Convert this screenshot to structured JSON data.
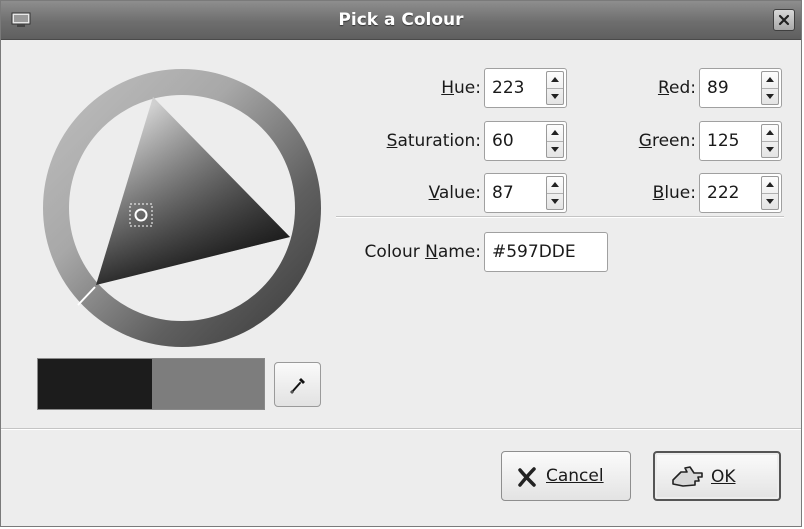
{
  "window": {
    "title": "Pick a Colour"
  },
  "icons": {
    "window": "window-menu-icon",
    "close": "close-icon",
    "eyedropper": "eyedropper-icon",
    "cancel": "cancel-x-icon",
    "ok": "ok-hand-icon"
  },
  "hsv": {
    "hue": {
      "label": "Hue:",
      "value": "223"
    },
    "saturation": {
      "label": "Saturation:",
      "value": "60"
    },
    "value": {
      "label": "Value:",
      "value": "87"
    }
  },
  "rgb": {
    "red": {
      "label": "Red:",
      "value": "89"
    },
    "green": {
      "label": "Green:",
      "value": "125"
    },
    "blue": {
      "label": "Blue:",
      "value": "222"
    }
  },
  "colour_name": {
    "label": "Colour Name:",
    "value": "#597DDE"
  },
  "buttons": {
    "cancel": "Cancel",
    "ok": "OK"
  },
  "colors": {
    "current": "#1c1c1c",
    "previous": "#7d7d7d",
    "selected_hex": "#597DDE"
  }
}
